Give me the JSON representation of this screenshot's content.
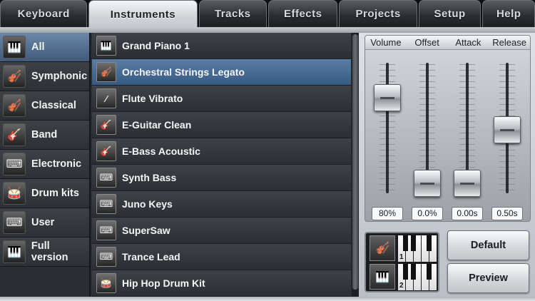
{
  "tabs": [
    "Keyboard",
    "Instruments",
    "Tracks",
    "Effects",
    "Projects",
    "Setup",
    "Help"
  ],
  "active_tab": "Instruments",
  "categories": [
    {
      "label": "All",
      "icon": "grand-piano-icon",
      "active": true
    },
    {
      "label": "Symphonic",
      "icon": "violin-icon"
    },
    {
      "label": "Classical",
      "icon": "cello-icon"
    },
    {
      "label": "Band",
      "icon": "electric-guitar-icon"
    },
    {
      "label": "Electronic",
      "icon": "synthesizer-icon"
    },
    {
      "label": "Drum kits",
      "icon": "drum-kit-icon"
    },
    {
      "label": "User",
      "icon": "user-preset-icon"
    },
    {
      "label": "Full version",
      "icon": "full-version-icon"
    }
  ],
  "instruments": [
    {
      "label": "Grand Piano 1",
      "icon": "grand-piano-icon"
    },
    {
      "label": "Orchestral Strings Legato",
      "icon": "strings-icon",
      "active": true
    },
    {
      "label": "Flute Vibrato",
      "icon": "flute-icon"
    },
    {
      "label": "E-Guitar Clean",
      "icon": "electric-guitar-icon"
    },
    {
      "label": "E-Bass Acoustic",
      "icon": "bass-guitar-icon"
    },
    {
      "label": "Synth Bass",
      "icon": "synth-keyboard-icon"
    },
    {
      "label": "Juno Keys",
      "icon": "synth-keyboard-icon"
    },
    {
      "label": "SuperSaw",
      "icon": "synth-keyboard-icon"
    },
    {
      "label": "Trance Lead",
      "icon": "synth-keyboard-icon"
    },
    {
      "label": "Hip Hop Drum Kit",
      "icon": "hiphop-kit-icon"
    }
  ],
  "mixer": {
    "headers": [
      "Volume",
      "Offset",
      "Attack",
      "Release"
    ],
    "values": [
      "80%",
      "0.0%",
      "0.00s",
      "0.50s"
    ],
    "levels": [
      0.8,
      0.0,
      0.0,
      0.5
    ]
  },
  "keyboard_slots": [
    "1",
    "2"
  ],
  "buttons": {
    "default_label": "Default",
    "preview_label": "Preview"
  },
  "colors": {
    "accent": "#4a6f98",
    "selected_row": "#5a7ea6"
  }
}
